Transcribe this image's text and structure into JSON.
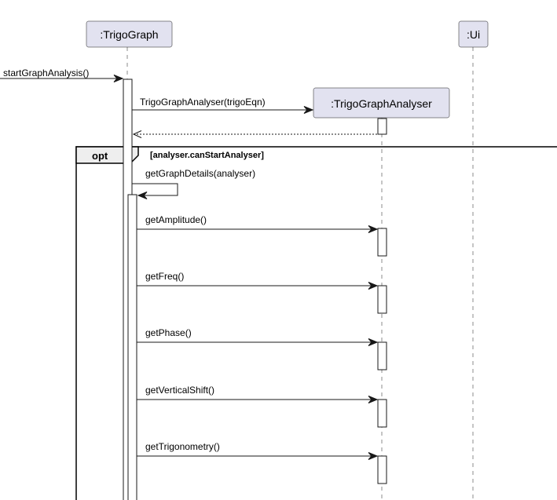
{
  "participants": {
    "trigo_graph": ":TrigoGraph",
    "ui": ":Ui",
    "analyser": ":TrigoGraphAnalyser"
  },
  "messages": {
    "start": "startGraphAnalysis()",
    "create_analyser": "TrigoGraphAnalyser(trigoEqn)",
    "get_graph_details": "getGraphDetails(analyser)",
    "get_amplitude": "getAmplitude()",
    "get_freq": "getFreq()",
    "get_phase": "getPhase()",
    "get_vertical_shift": "getVerticalShift()",
    "get_trigonometry": "getTrigonometry()"
  },
  "fragment": {
    "operator": "opt",
    "guard": "[analyser.canStartAnalyser]"
  }
}
